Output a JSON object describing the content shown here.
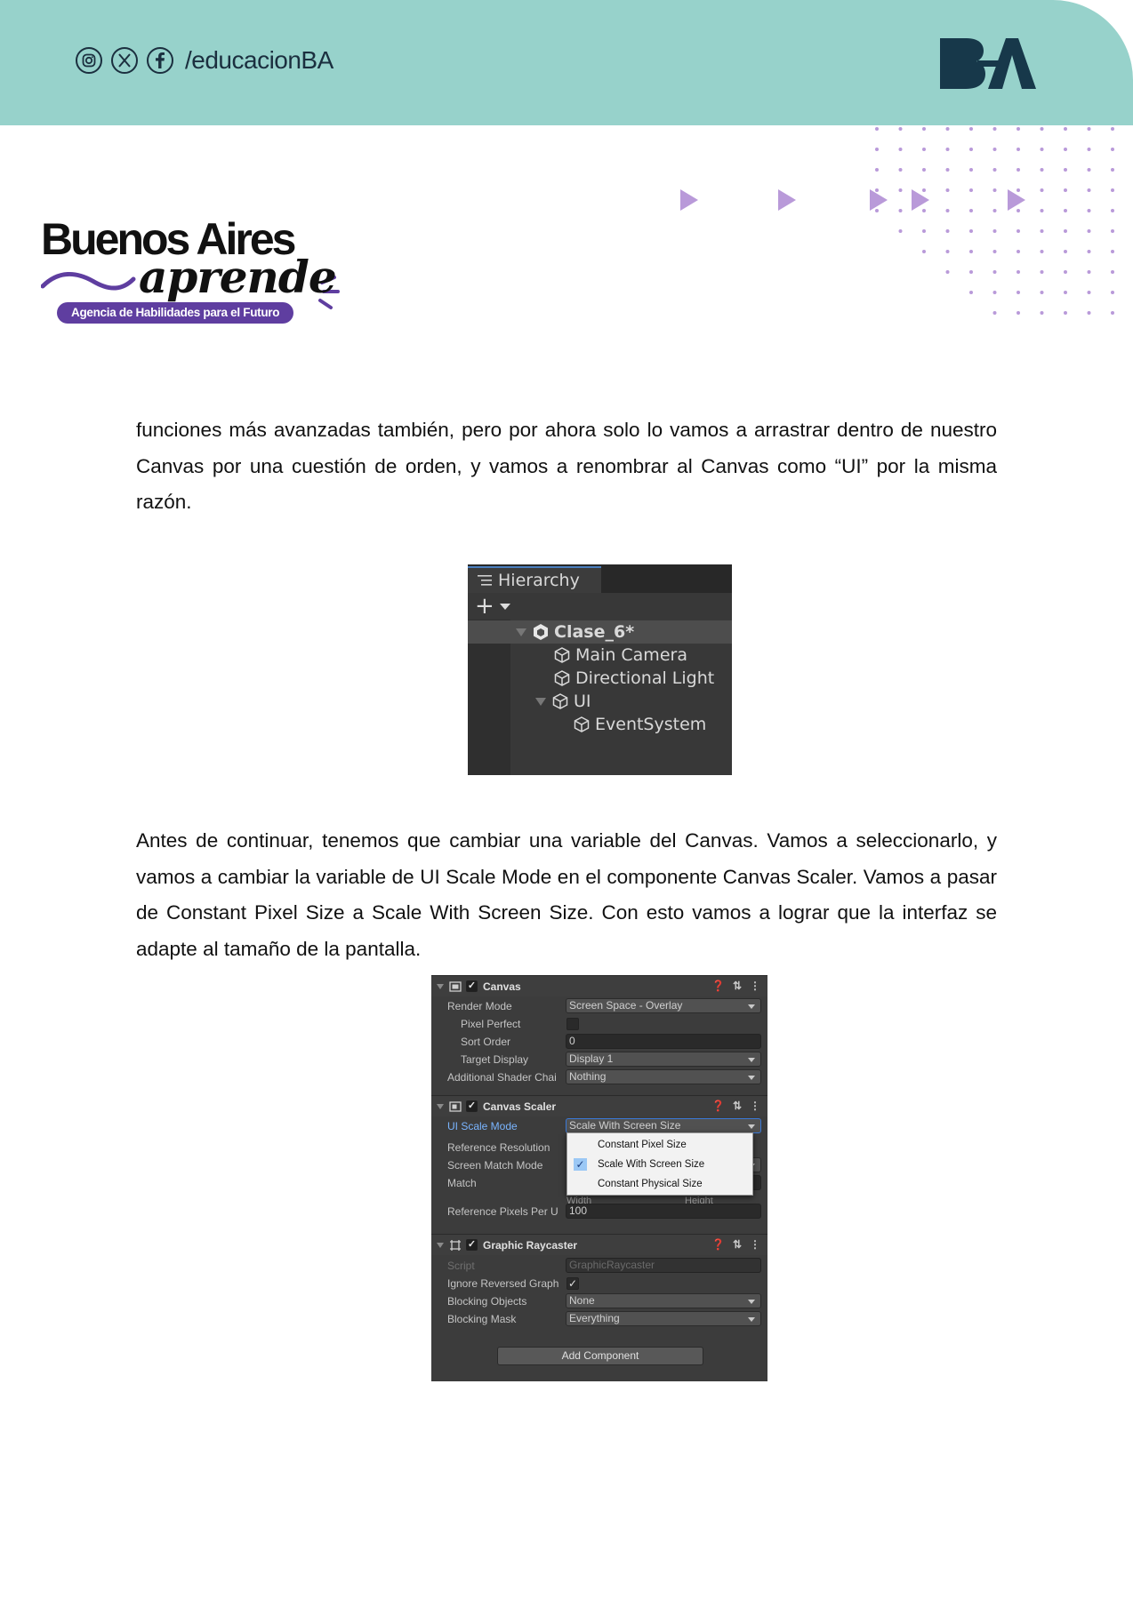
{
  "header": {
    "social_handle": "/educacionBA",
    "social_icons": [
      "instagram-icon",
      "x-twitter-icon",
      "facebook-icon"
    ],
    "ba_logo_text": "BA",
    "band_color": "#97d2cb"
  },
  "brand": {
    "title": "Buenos Aires",
    "script": "aprende",
    "tagline": "Agencia de Habilidades para el Futuro",
    "accent_color": "#5f3ea0"
  },
  "body": {
    "paragraph1": "funciones más avanzadas también, pero por ahora solo lo vamos a arrastrar dentro de nuestro Canvas por una cuestión de orden, y vamos a renombrar al Canvas como “UI” por la misma razón.",
    "paragraph2": "Antes de continuar, tenemos que cambiar una variable del Canvas. Vamos a seleccionarlo, y vamos a cambiar la variable de UI Scale Mode en el componente Canvas Scaler. Vamos a pasar de Constant Pixel Size a Scale With Screen Size. Con esto vamos a lograr que la interfaz se adapte al tamaño de la pantalla."
  },
  "hierarchy": {
    "tab_label": "Hierarchy",
    "plus_label": "+",
    "scene_name": "Clase_6*",
    "items": [
      {
        "label": "Main Camera"
      },
      {
        "label": "Directional Light"
      },
      {
        "label": "UI"
      },
      {
        "label": "EventSystem"
      }
    ]
  },
  "inspector": {
    "canvas": {
      "title": "Canvas",
      "render_mode_label": "Render Mode",
      "render_mode_value": "Screen Space - Overlay",
      "pixel_perfect_label": "Pixel Perfect",
      "sort_order_label": "Sort Order",
      "sort_order_value": "0",
      "target_display_label": "Target Display",
      "target_display_value": "Display 1",
      "shader_label": "Additional Shader Chai",
      "shader_value": "Nothing"
    },
    "scaler": {
      "title": "Canvas Scaler",
      "ui_scale_mode_label": "UI Scale Mode",
      "ui_scale_mode_value": "Scale With Screen Size",
      "ref_resolution_label": "Reference Resolution",
      "screen_match_label": "Screen Match Mode",
      "match_label": "Match",
      "width_hint": "Width",
      "height_hint": "Height",
      "ref_pixels_label": "Reference Pixels Per U",
      "ref_pixels_value": "100",
      "dropdown_options": [
        {
          "label": "Constant Pixel Size"
        },
        {
          "label": "Scale With Screen Size"
        },
        {
          "label": "Constant Physical Size"
        }
      ],
      "selected_option": "Scale With Screen Size"
    },
    "raycaster": {
      "title": "Graphic Raycaster",
      "script_label": "Script",
      "script_value": "GraphicRaycaster",
      "ignore_label": "Ignore Reversed Graph",
      "blocking_objects_label": "Blocking Objects",
      "blocking_objects_value": "None",
      "blocking_mask_label": "Blocking Mask",
      "blocking_mask_value": "Everything"
    },
    "add_component_label": "Add Component"
  }
}
